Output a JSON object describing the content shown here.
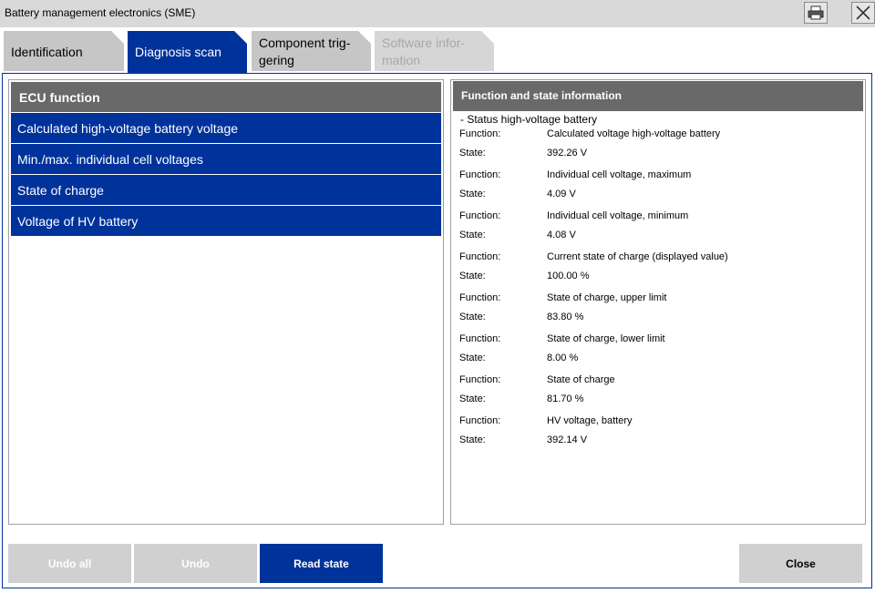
{
  "window": {
    "title": "Battery management electronics (SME)",
    "print_icon": "printer-icon",
    "close_icon": "close-icon"
  },
  "tabs": [
    {
      "line1": "Identification",
      "line2": ""
    },
    {
      "line1": "Diagnosis scan",
      "line2": ""
    },
    {
      "line1": "Component trig-",
      "line2": "gering"
    },
    {
      "line1": "Software infor-",
      "line2": "mation"
    }
  ],
  "left_panel": {
    "header": "ECU function",
    "items": [
      "Calculated high-voltage battery voltage",
      "Min./max. individual cell voltages",
      "State of charge",
      "Voltage of HV battery"
    ]
  },
  "right_panel": {
    "header": "Function and state information",
    "group": "- Status high-voltage battery",
    "function_label": "Function:",
    "state_label": "State:",
    "entries": [
      {
        "function": "Calculated voltage high-voltage battery",
        "state": "392.26  V"
      },
      {
        "function": "Individual cell voltage, maximum",
        "state": "4.09  V"
      },
      {
        "function": "Individual cell voltage, minimum",
        "state": "4.08  V"
      },
      {
        "function": "Current state of charge (displayed value)",
        "state": "100.00  %"
      },
      {
        "function": "State of charge, upper limit",
        "state": "83.80  %"
      },
      {
        "function": "State of charge, lower limit",
        "state": "8.00  %"
      },
      {
        "function": "State of charge",
        "state": "81.70  %"
      },
      {
        "function": "HV voltage, battery",
        "state": "392.14  V"
      }
    ]
  },
  "buttons": {
    "undo_all": "Undo all",
    "undo": "Undo",
    "read_state": "Read state",
    "close": "Close"
  },
  "colors": {
    "accent": "#00329b",
    "header_gray": "#696969",
    "tab_gray": "#c6c6c6",
    "button_gray": "#d0d0d0"
  }
}
